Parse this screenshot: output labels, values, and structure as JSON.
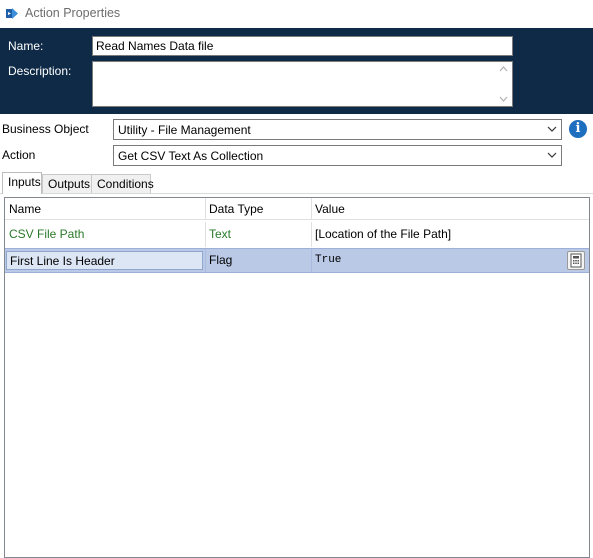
{
  "window": {
    "title": "Action Properties"
  },
  "header": {
    "name_label": "Name:",
    "name_value": "Read Names Data file",
    "description_label": "Description:",
    "description_value": ""
  },
  "business_object": {
    "label": "Business Object",
    "value": "Utility - File Management"
  },
  "action": {
    "label": "Action",
    "value": "Get CSV Text As Collection"
  },
  "tabs": [
    {
      "label": "Inputs",
      "active": true
    },
    {
      "label": "Outputs",
      "active": false
    },
    {
      "label": "Conditions",
      "active": false
    }
  ],
  "grid": {
    "columns": [
      "Name",
      "Data Type",
      "Value"
    ],
    "rows": [
      {
        "name": "CSV File Path",
        "data_type": "Text",
        "value": "[Location of the File Path]"
      },
      {
        "name": "First Line Is Header",
        "data_type": "Flag",
        "value": "True"
      }
    ]
  },
  "colors": {
    "header_bg": "#0e2a47",
    "selected_row": "#b9c9e6",
    "green_text": "#2a7a2a",
    "info_blue": "#1e6fbd"
  },
  "icons": {
    "app": "action-stage-icon",
    "info": "info-icon",
    "calculator": "calculator-icon"
  }
}
